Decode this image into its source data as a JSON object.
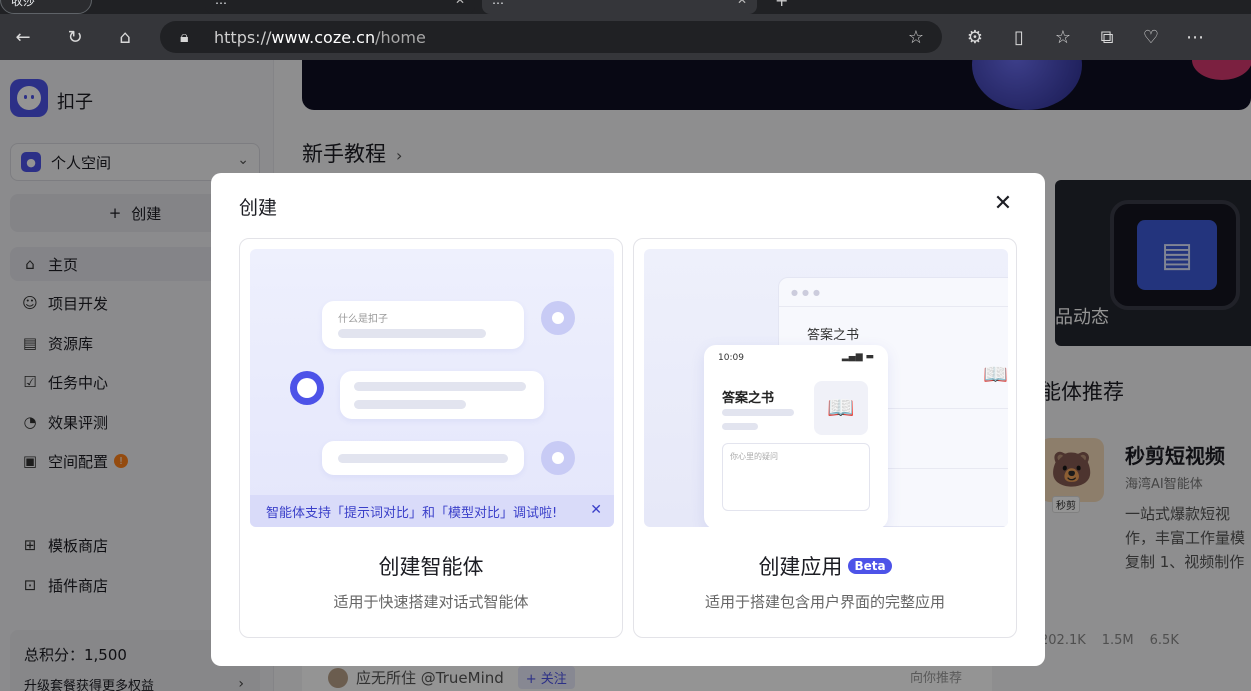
{
  "browser": {
    "tabs": [
      {
        "label": "收莎"
      },
      {
        "label": "…"
      },
      {
        "label": "…"
      }
    ],
    "url_prefix": "https://",
    "url_host": "www.coze.cn",
    "url_path": "/home"
  },
  "sidebar": {
    "brand": "扣子",
    "space": "个人空间",
    "create": "创建",
    "nav": [
      {
        "label": "主页",
        "icon": "home-icon"
      },
      {
        "label": "项目开发",
        "icon": "bot-icon"
      },
      {
        "label": "资源库",
        "icon": "library-icon"
      },
      {
        "label": "任务中心",
        "icon": "task-icon"
      },
      {
        "label": "效果评测",
        "icon": "gauge-icon"
      },
      {
        "label": "空间配置",
        "icon": "settings-icon",
        "badge": "!"
      }
    ],
    "nav2": [
      {
        "label": "模板商店",
        "icon": "template-icon"
      },
      {
        "label": "插件商店",
        "icon": "plugin-icon"
      }
    ],
    "points_label": "总积分：1,500",
    "upgrade": "升级套餐获得更多权益"
  },
  "main": {
    "section_title": "新手教程",
    "card_text": "品动态",
    "rec_title": "能体推荐",
    "bot": {
      "name": "秒剪短视频",
      "by": "海湾AI智能体",
      "tag": "秒剪",
      "desc1": "一站式爆款短视",
      "desc2": "作，丰富工作量模",
      "desc3": "复制 1、视频制作",
      "stat1": "202.1K",
      "stat2": "1.5M",
      "stat3": "6.5K"
    },
    "bottom_user": "应无所住 @TrueMind",
    "follow": "+ 关注",
    "hint": "向你推荐"
  },
  "modal": {
    "title": "创建",
    "option1": {
      "title": "创建智能体",
      "subtitle": "适用于快速搭建对话式智能体",
      "notice": "智能体支持「提示词对比」和「模型对比」调试啦!",
      "question": "什么是扣子"
    },
    "option2": {
      "title": "创建应用",
      "beta": "Beta",
      "subtitle": "适用于搭建包含用户界面的完整应用",
      "window_title": "答案之书",
      "phone_time": "10:09",
      "phone_title": "答案之书",
      "placeholder": "你心里的疑问"
    }
  }
}
